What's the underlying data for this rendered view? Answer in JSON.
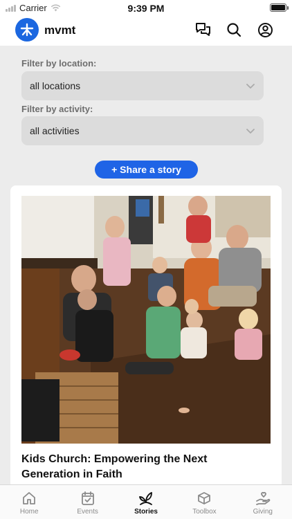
{
  "status": {
    "carrier": "Carrier",
    "time": "9:39 PM"
  },
  "header": {
    "brand": "mvmt",
    "icons": [
      "chat-icon",
      "search-icon",
      "profile-icon"
    ]
  },
  "filters": {
    "location_label": "Filter by location:",
    "location_value": "all locations",
    "activity_label": "Filter by activity:",
    "activity_value": "all activities"
  },
  "share_button": {
    "label": "+ Share a story"
  },
  "story": {
    "title": "Kids Church: Empowering the Next Generation in Faith"
  },
  "tabs": [
    {
      "label": "Home",
      "icon": "home-icon",
      "active": false
    },
    {
      "label": "Events",
      "icon": "calendar-check-icon",
      "active": false
    },
    {
      "label": "Stories",
      "icon": "sprout-icon",
      "active": true
    },
    {
      "label": "Toolbox",
      "icon": "box-icon",
      "active": false
    },
    {
      "label": "Giving",
      "icon": "hand-heart-icon",
      "active": false
    }
  ],
  "colors": {
    "accent": "#1f64e6",
    "logo": "#1b67e0"
  }
}
